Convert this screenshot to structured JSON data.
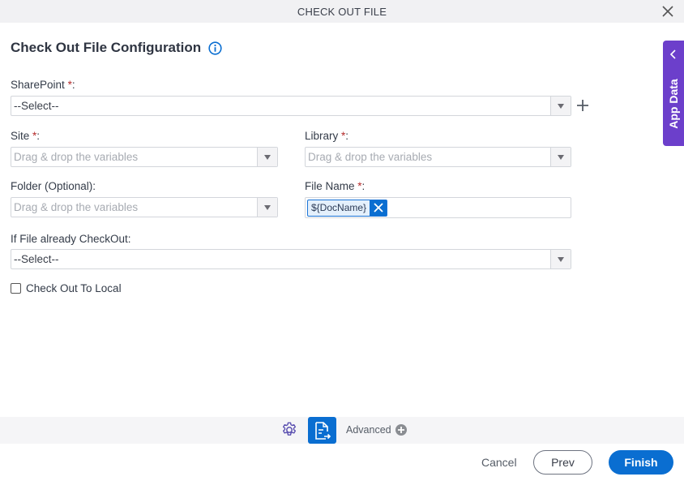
{
  "window": {
    "title": "CHECK OUT FILE",
    "close_icon": "close-icon"
  },
  "heading": {
    "title": "Check Out File Configuration",
    "info_icon": "info-icon"
  },
  "form": {
    "sharepoint": {
      "label": "SharePoint",
      "required_mark": "*",
      "suffix": ":",
      "value": "--Select--"
    },
    "site": {
      "label": "Site",
      "required_mark": "*",
      "suffix": ":",
      "placeholder": "Drag & drop the variables"
    },
    "library": {
      "label": "Library",
      "required_mark": "*",
      "suffix": ":",
      "placeholder": "Drag & drop the variables"
    },
    "folder": {
      "label": "Folder (Optional):",
      "placeholder": "Drag & drop the variables"
    },
    "file_name": {
      "label": "File Name",
      "required_mark": "*",
      "suffix": ":",
      "chip": "${DocName}"
    },
    "if_checked_out": {
      "label": "If File already CheckOut:",
      "value": "--Select--"
    },
    "check_out_to_local": {
      "label": "Check Out To Local",
      "checked": false
    }
  },
  "side_panel": {
    "label": "App Data"
  },
  "toolbar": {
    "advanced_label": "Advanced"
  },
  "footer": {
    "cancel": "Cancel",
    "prev": "Prev",
    "finish": "Finish"
  },
  "colors": {
    "accent": "#0a6ed1",
    "side_panel": "#6c3fcb",
    "required": "#b42b2b"
  }
}
